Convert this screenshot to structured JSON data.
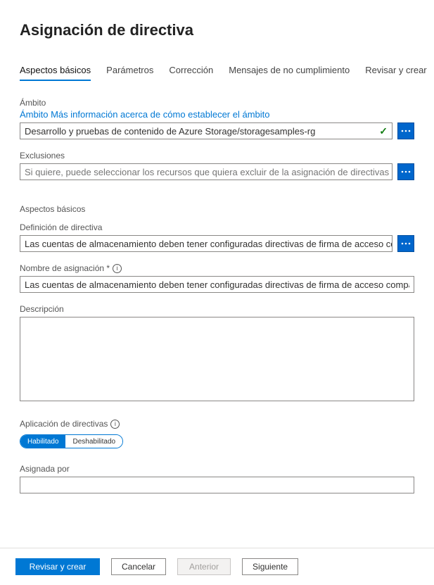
{
  "page_title": "Asignación de directiva",
  "tabs": [
    {
      "label": "Aspectos básicos",
      "active": true
    },
    {
      "label": "Parámetros",
      "active": false
    },
    {
      "label": "Corrección",
      "active": false
    },
    {
      "label": "Mensajes de no cumplimiento",
      "active": false
    },
    {
      "label": "Revisar y crear",
      "active": false
    }
  ],
  "scope": {
    "label": "Ámbito",
    "help_link": "Ámbito Más información acerca de cómo establecer el ámbito",
    "value": "Desarrollo y pruebas de contenido de Azure Storage/storagesamples-rg"
  },
  "exclusions": {
    "label": "Exclusiones",
    "placeholder": "Si quiere, puede seleccionar los recursos que quiera excluir de la asignación de directivas"
  },
  "basics_heading": "Aspectos básicos",
  "policy_def": {
    "label": "Definición de directiva",
    "value": "Las cuentas de almacenamiento deben tener configuradas directivas de firma de acceso compartido (SA"
  },
  "assignment_name": {
    "label": "Nombre de asignación *",
    "value": "Las cuentas de almacenamiento deben tener configuradas directivas de firma de acceso compartido (SA"
  },
  "description": {
    "label": "Descripción",
    "value": ""
  },
  "enforcement": {
    "label": "Aplicación de directivas",
    "options": [
      "Habilitado",
      "Deshabilitado"
    ],
    "selected": "Habilitado"
  },
  "assigned_by": {
    "label": "Asignada por",
    "value": ""
  },
  "footer": {
    "review_create": "Revisar y crear",
    "cancel": "Cancelar",
    "previous": "Anterior",
    "next": "Siguiente"
  }
}
